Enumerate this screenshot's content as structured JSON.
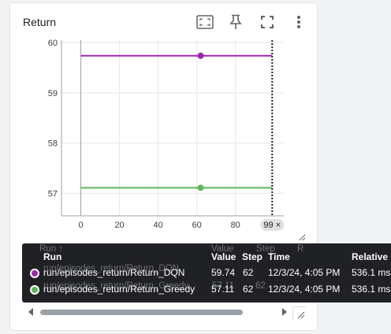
{
  "card": {
    "title": "Return",
    "tools": [
      "fit-domain-icon",
      "pin-icon",
      "fullscreen-icon",
      "more-vert-icon"
    ]
  },
  "chart_data": {
    "type": "line",
    "xlim": [
      -10,
      105
    ],
    "ylim": [
      56.55,
      60.05
    ],
    "x_ticks": [
      0,
      20,
      40,
      60,
      80
    ],
    "y_ticks": [
      57,
      58,
      59,
      60
    ],
    "x_tick_labels": [
      "0",
      "20",
      "40",
      "60",
      "80"
    ],
    "y_tick_labels": [
      "57",
      "58",
      "59",
      "60"
    ],
    "grid": true,
    "cursor_x": 99,
    "cursor_label": "99 ×",
    "series": [
      {
        "name": "run/episodes_return/Return_DQN",
        "color": "#9c27b0",
        "x": [
          0,
          99
        ],
        "y": [
          59.74,
          59.74
        ],
        "highlight_x": 62
      },
      {
        "name": "run/episodes_return/Return_Greedy",
        "color": "#5cb85c",
        "x": [
          0,
          99
        ],
        "y": [
          57.11,
          57.11
        ],
        "highlight_x": 62
      }
    ]
  },
  "tooltip": {
    "ghost": {
      "run": "Run ↑",
      "value": "Value",
      "step": "Step",
      "r": "R",
      "row1_name": "run/episodes_return/Return_DQN",
      "row2_name": "run/episodes_return/Return_Greedy",
      "row2_value": "57.11",
      "row2_step": "62"
    },
    "headers": {
      "run": "Run",
      "value": "Value",
      "step": "Step",
      "time": "Time",
      "relative": "Relative"
    },
    "rows": [
      {
        "color": "#9c27b0",
        "run": "run/episodes_return/Return_DQN",
        "value": "59.74",
        "step": "62",
        "time": "12/3/24, 4:05 PM",
        "relative": "536.1 ms"
      },
      {
        "color": "#5cb85c",
        "run": "run/episodes_return/Return_Greedy",
        "value": "57.11",
        "step": "62",
        "time": "12/3/24, 4:05 PM",
        "relative": "536.1 ms"
      }
    ]
  }
}
